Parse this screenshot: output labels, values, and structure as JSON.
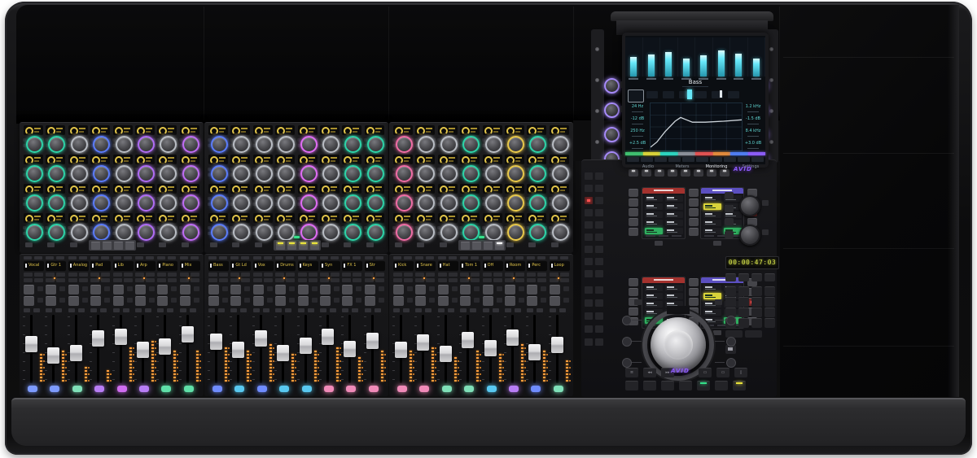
{
  "brand": {
    "logo_text": "AVID"
  },
  "master": {
    "timecode": "00:00:47:03",
    "knob_ring_color": "#a78bfa",
    "screen": {
      "title": "Bass",
      "meters": [
        0.55,
        0.62,
        0.68,
        0.5,
        0.6,
        0.72,
        0.64,
        0.5
      ],
      "eq_curve": [
        [
          0,
          0.93
        ],
        [
          0.07,
          0.82
        ],
        [
          0.16,
          0.6
        ],
        [
          0.27,
          0.38
        ],
        [
          0.33,
          0.3
        ],
        [
          0.38,
          0.34
        ],
        [
          0.46,
          0.4
        ],
        [
          0.6,
          0.4
        ],
        [
          0.8,
          0.38
        ],
        [
          1,
          0.35
        ]
      ],
      "left_params": [
        "24 Hz",
        "-12 dB",
        "250 Hz",
        "+2.5 dB"
      ],
      "right_params": [
        "1.2 kHz",
        "-1.5 dB",
        "8.4 kHz",
        "+3.0 dB"
      ],
      "color_strip": [
        "#3fbf6f",
        "#d8d23a",
        "#2dd4bf",
        "#8a8f98",
        "#e05252",
        "#e08a3c",
        "#4f7df0",
        "#8b5cf6"
      ],
      "menu_labels": [
        "Audio",
        "Meters",
        "Monitoring",
        "Settings"
      ]
    },
    "softkeys": {
      "lcd_a_header": "#a3322e",
      "lcd_b_header": "#5b4fc0",
      "green": "#2fae5f",
      "yellow": "#d8d23a",
      "cells_a": [
        [
          "icon",
          "icon"
        ],
        [
          "icon",
          "icon"
        ],
        [
          "icon",
          "icon"
        ],
        [
          "icon",
          "icon"
        ],
        [
          "green",
          "icon"
        ]
      ],
      "cells_b": [
        [
          "icon",
          "icon"
        ],
        [
          "yellow",
          "icon"
        ],
        [
          "icon",
          "icon"
        ],
        [
          "icon",
          "icon"
        ],
        [
          "icon",
          "green"
        ]
      ]
    },
    "transport": {
      "row1": [
        "≡",
        "◂◂",
        "▸▸",
        "▭",
        "▭",
        "▯"
      ],
      "row2": [
        "⏮",
        "◂",
        "▸",
        "■",
        "▶",
        "●",
        "⏏"
      ],
      "row2_leds": {
        "4": "#35e08a",
        "6": "#e8e23a"
      }
    }
  },
  "bays": [
    {
      "knob_columns": [
        "#2dd4a8",
        "#2dd4a8",
        "#b9bdc4",
        "#5b7cfa",
        "#b9bdc4",
        "#b06df5",
        "#b9bdc4",
        "#c06df5"
      ],
      "bank_led": null,
      "status_led": null,
      "channels": [
        {
          "name": "Vocal",
          "chip": "#7d9bff",
          "fader": 0.4,
          "meter": 0.45
        },
        {
          "name": "Gtr 1",
          "chip": "#7d9bff",
          "fader": 0.62,
          "meter": 0.55
        },
        {
          "name": "Analog",
          "chip": "#7fe0b8",
          "fader": 0.58,
          "meter": 0.25
        },
        {
          "name": "Pad",
          "chip": "#b87df5",
          "fader": 0.3,
          "meter": 0.2
        },
        {
          "name": "Lib",
          "chip": "#cf6df0",
          "fader": 0.26,
          "meter": 0.6
        },
        {
          "name": "Arp",
          "chip": "#b87df5",
          "fader": 0.52,
          "meter": 0.7
        },
        {
          "name": "Piano",
          "chip": "#5fe0a8",
          "fader": 0.46,
          "meter": 0.5
        },
        {
          "name": "Mix",
          "chip": "#5fe0a8",
          "fader": 0.22,
          "meter": 0.55
        }
      ]
    },
    {
      "knob_columns": [
        "#5b7cfa",
        "#b9bdc4",
        "#b9bdc4",
        "#b9bdc4",
        "#e06df5",
        "#b9bdc4",
        "#2dd4a8",
        "#2dd4a8"
      ],
      "bank_led": "#e8e23a",
      "status_led": "#35e08a",
      "channels": [
        {
          "name": "Bass",
          "chip": "#6f8cff",
          "fader": 0.36,
          "meter": 0.6
        },
        {
          "name": "Gt Ld",
          "chip": "#58c8f0",
          "fader": 0.52,
          "meter": 0.5
        },
        {
          "name": "Vox",
          "chip": "#6f8cff",
          "fader": 0.3,
          "meter": 0.65
        },
        {
          "name": "Drums",
          "chip": "#58c8f0",
          "fader": 0.58,
          "meter": 0.45
        },
        {
          "name": "Keys",
          "chip": "#58c8f0",
          "fader": 0.44,
          "meter": 0.55
        },
        {
          "name": "Syn",
          "chip": "#f08ab8",
          "fader": 0.26,
          "meter": 0.6
        },
        {
          "name": "FX 1",
          "chip": "#f08ab8",
          "fader": 0.5,
          "meter": 0.4
        },
        {
          "name": "Str",
          "chip": "#f08ab8",
          "fader": 0.34,
          "meter": 0.5
        }
      ]
    },
    {
      "knob_columns": [
        "#f06da5",
        "#b9bdc4",
        "#b9bdc4",
        "#2dd4a8",
        "#b9bdc4",
        "#e8c84a",
        "#2dd4a8",
        "#b9bdc4"
      ],
      "bank_led": "#ffffff",
      "status_led": "#35e08a",
      "channels": [
        {
          "name": "Kick",
          "chip": "#f08ab8",
          "fader": 0.52,
          "meter": 0.5
        },
        {
          "name": "Snare",
          "chip": "#f08ab8",
          "fader": 0.38,
          "meter": 0.6
        },
        {
          "name": "Hat",
          "chip": "#7fe0b8",
          "fader": 0.6,
          "meter": 0.4
        },
        {
          "name": "Tom 1",
          "chip": "#7fe0b8",
          "fader": 0.33,
          "meter": 0.55
        },
        {
          "name": "OH",
          "chip": "#58c8f0",
          "fader": 0.48,
          "meter": 0.45
        },
        {
          "name": "Room",
          "chip": "#b87df5",
          "fader": 0.28,
          "meter": 0.65
        },
        {
          "name": "Perc",
          "chip": "#6f8cff",
          "fader": 0.56,
          "meter": 0.5
        },
        {
          "name": "Loop",
          "chip": "#7fe0b8",
          "fader": 0.42,
          "meter": 0.35
        }
      ]
    }
  ]
}
